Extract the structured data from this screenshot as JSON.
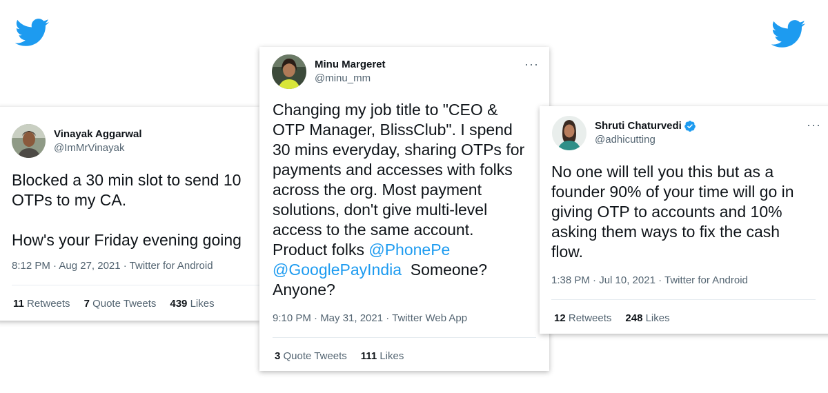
{
  "brand": {
    "icon": "twitter-bird-icon",
    "color": "#1d9bf0"
  },
  "tweets": [
    {
      "display_name": "Vinayak Aggarwal",
      "handle": "@ImMrVinayak",
      "text_line1": "Blocked a 30 min slot to send 10",
      "text_line2": "OTPs to my CA.",
      "text_line3": "How's your Friday evening going",
      "meta": "8:12 PM · Aug 27, 2021 · Twitter for Android",
      "retweets_count": "11",
      "retweets_label": "Retweets",
      "quotes_count": "7",
      "quotes_label": "Quote Tweets",
      "likes_count": "439",
      "likes_label": "Likes"
    },
    {
      "display_name": "Minu Margeret",
      "handle": "@minu_mm",
      "more": "···",
      "text_line1": "Changing my job title to \"CEO &",
      "text_line2": "OTP Manager, BlissClub\". I spend",
      "text_line3": "30 mins everyday, sharing OTPs for",
      "text_line4": "payments and accesses with folks",
      "text_line5": "across the org. Most payment",
      "text_line6": "solutions, don't give multi-level",
      "text_line7": "access to the same account.",
      "text_line8_prefix": "Product folks ",
      "mention1": "@PhonePe",
      "mention2": "@GooglePayIndia",
      "text_line9_suffix": "  Someone?",
      "text_line10": "Anyone?",
      "meta": "9:10 PM · May 31, 2021 · Twitter Web App",
      "quotes_count": "3",
      "quotes_label": "Quote Tweets",
      "likes_count": "111",
      "likes_label": "Likes"
    },
    {
      "display_name": "Shruti Chaturvedi",
      "handle": "@adhicutting",
      "verified_icon": "verified-badge-icon",
      "more": "···",
      "text_line1": "No one will tell you this but as a",
      "text_line2": "founder 90% of your time will go in",
      "text_line3": "giving OTP to accounts and 10%",
      "text_line4": "asking them ways to fix the cash",
      "text_line5": "flow.",
      "meta": "1:38 PM · Jul 10, 2021 · Twitter for Android",
      "retweets_count": "12",
      "retweets_label": "Retweets",
      "likes_count": "248",
      "likes_label": "Likes"
    }
  ]
}
